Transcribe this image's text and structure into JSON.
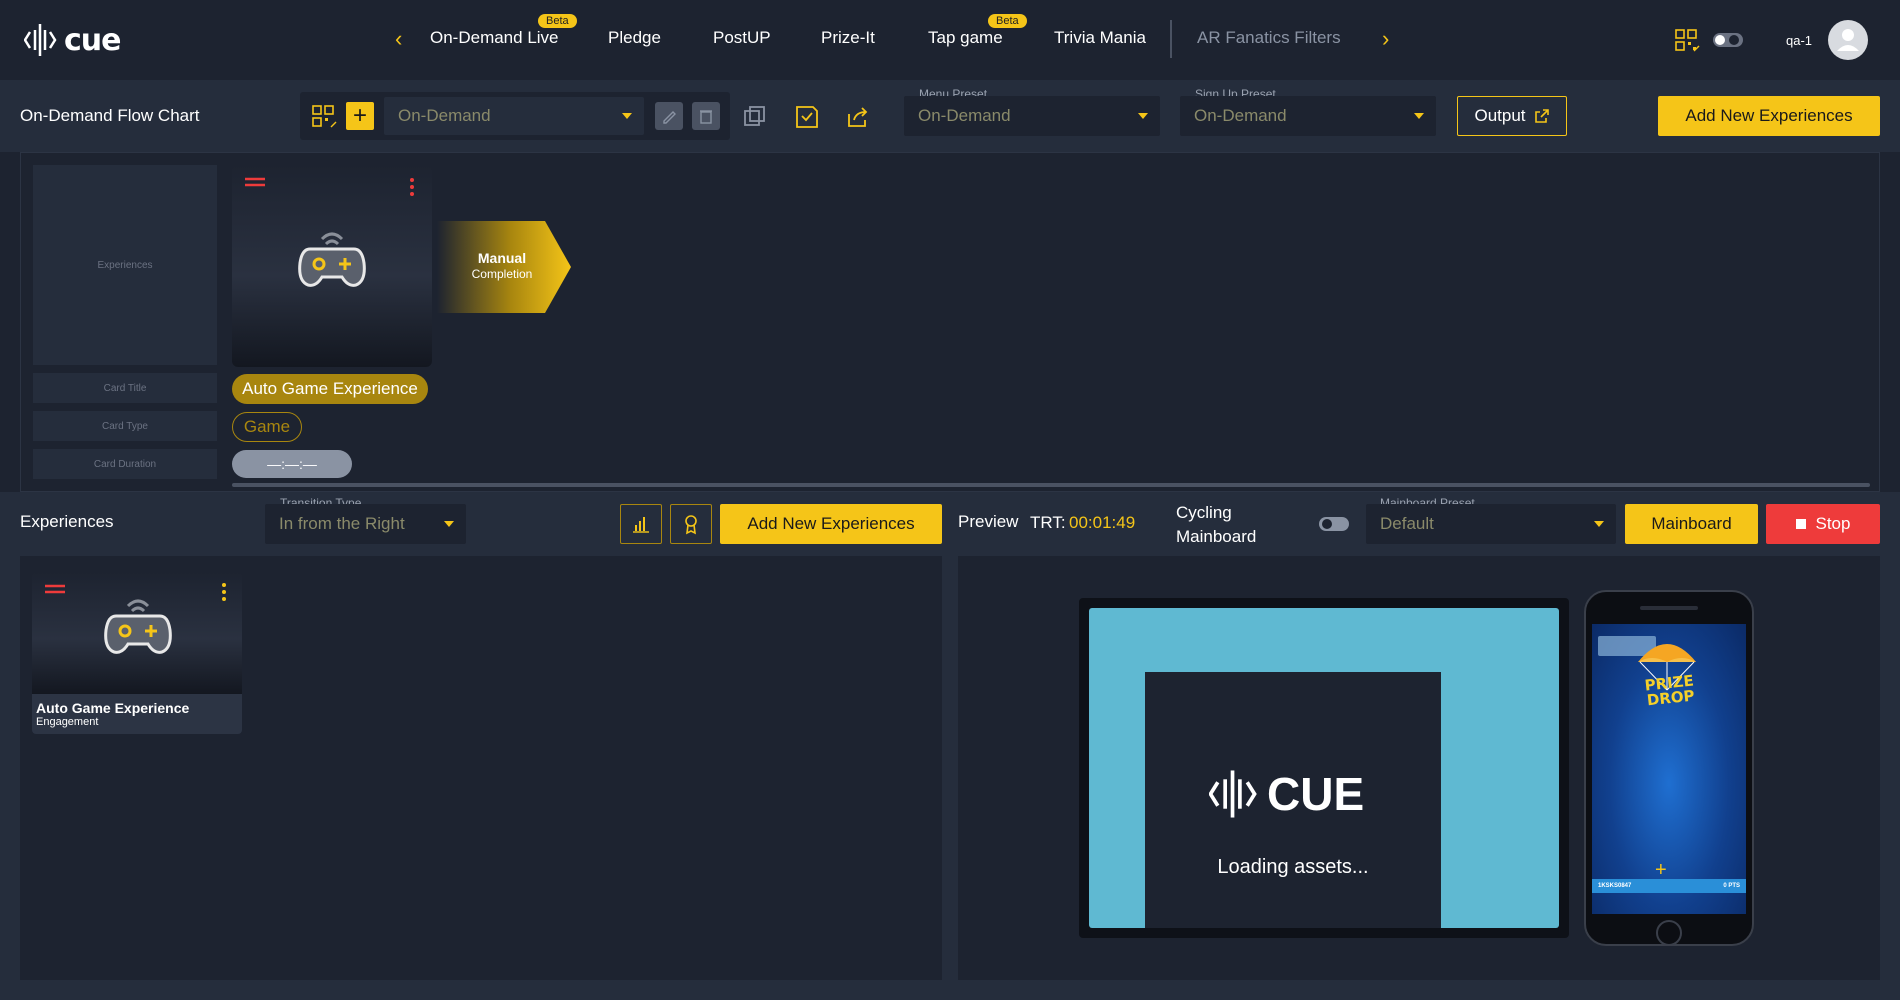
{
  "brand": {
    "logo_text": "cue"
  },
  "nav": {
    "items": [
      {
        "label": "On-Demand Live",
        "beta": "Beta"
      },
      {
        "label": "Pledge"
      },
      {
        "label": "PostUP"
      },
      {
        "label": "Prize-It"
      },
      {
        "label": "Tap game",
        "beta": "Beta"
      },
      {
        "label": "Trivia Mania"
      },
      {
        "label": "AR Fanatics Filters"
      }
    ]
  },
  "user": {
    "name": "qa-1"
  },
  "flow": {
    "title": "On-Demand Flow Chart",
    "flow_select": "On-Demand",
    "menu_preset_label": "Menu Preset",
    "menu_preset": "On-Demand",
    "signup_preset_label": "Sign Up Preset",
    "signup_preset": "On-Demand",
    "output_label": "Output",
    "add_label": "Add New Experiences"
  },
  "canvas": {
    "ghost_experiences": "Experiences",
    "ghost_card_title": "Card Title",
    "ghost_card_type": "Card Type",
    "ghost_card_duration": "Card Duration",
    "card_title": "Auto Game Experience",
    "card_type": "Game",
    "card_duration": "—:—:—",
    "completion_title": "Manual",
    "completion_sub": "Completion"
  },
  "experiences": {
    "title": "Experiences",
    "transition_label": "Transition Type",
    "transition": "In from the Right",
    "add_label": "Add New Experiences",
    "items": [
      {
        "title": "Auto Game Experience",
        "subtitle": "Engagement"
      }
    ]
  },
  "preview": {
    "label": "Preview",
    "trt_label": "TRT:",
    "trt_value": "00:01:49",
    "cycling_label": "Cycling\nMainboard",
    "mainboard_preset_label": "Mainboard Preset",
    "mainboard_preset": "Default",
    "mainboard_button": "Mainboard",
    "stop_button": "Stop",
    "screen_logo": "CUE",
    "loading_text": "Loading assets...",
    "phone_game_title_1": "PRIZE",
    "phone_game_title_2": "DROP",
    "phone_id": "1KSKS0847",
    "phone_pts": "0 PTS"
  },
  "colors": {
    "accent": "#f5c518",
    "stop": "#ee3b3b",
    "bg": "#1d2330",
    "panel": "#252d3c"
  }
}
